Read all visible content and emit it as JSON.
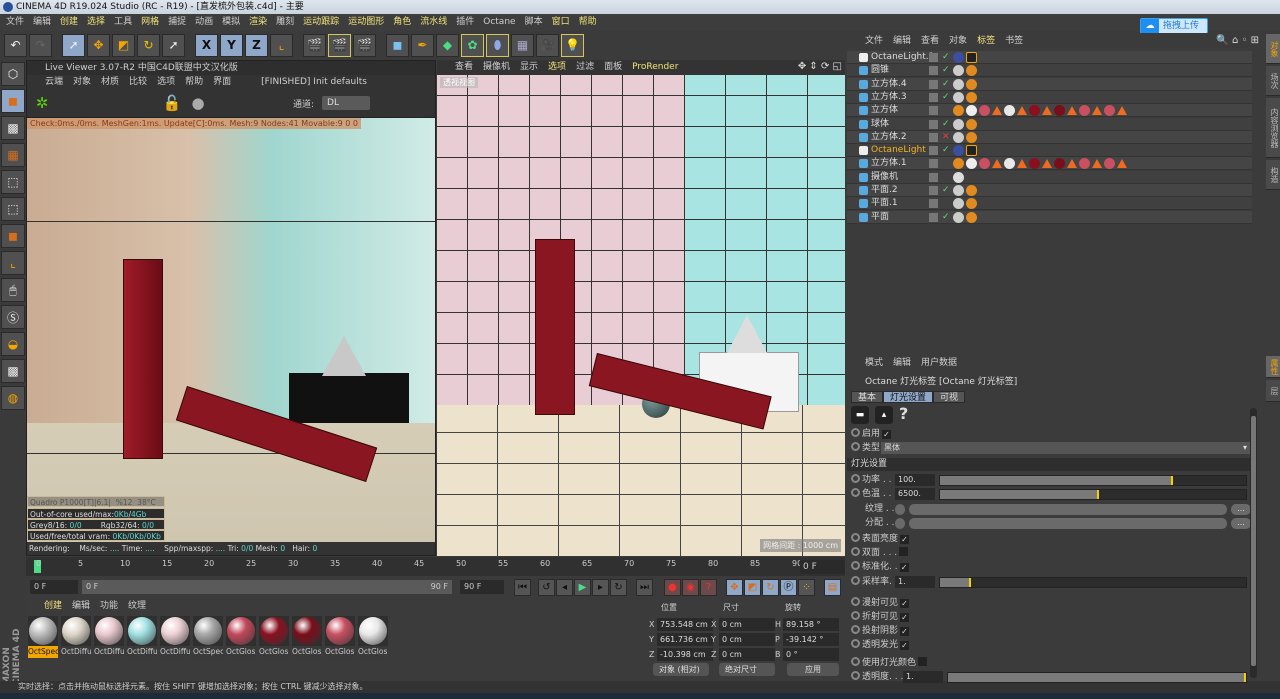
{
  "window": {
    "title": "CINEMA 4D R19.024 Studio (RC - R19) - [直发梳外包装.c4d] - 主要"
  },
  "menu": [
    "文件",
    "编辑",
    "创建",
    "选择",
    "工具",
    "网格",
    "捕捉",
    "动画",
    "模拟",
    "渲染",
    "雕刻",
    "运动跟踪",
    "运动图形",
    "角色",
    "流水线",
    "插件",
    "Octane",
    "脚本",
    "窗口",
    "帮助"
  ],
  "menu_highlighted": [
    "创建",
    "选择",
    "网格",
    "渲染",
    "运动跟踪",
    "运动图形",
    "角色",
    "流水线",
    "窗口",
    "帮助"
  ],
  "upload_button": "拖拽上传",
  "toolbar": {
    "axis": [
      "X",
      "Y",
      "Z"
    ]
  },
  "live_viewer": {
    "title": "Live Viewer 3.07-R2 中国C4D联盟中文汉化版",
    "menu": [
      "云端",
      "对象",
      "材质",
      "比较",
      "选项",
      "帮助",
      "界面"
    ],
    "status": "[FINISHED] Init defaults",
    "channel_label": "通道:",
    "channel_value": "DL",
    "check_line": "Check:0ms./0ms. MeshGen:1ms. Update[C]:0ms. Mesh:9 Nodes:41 Movable:9  0 0",
    "gpu": {
      "name": "Quadro P1000[T]|6.1|",
      "usage": "%12",
      "temp": "38°C"
    },
    "out_of_core": {
      "label": "Out-of-core used/max:",
      "used": "0Kb",
      "max": "4Gb"
    },
    "grey": {
      "label": "Grey8/16:",
      "value": "0/0"
    },
    "rgb": {
      "label": "Rgb32/64:",
      "value": "0/0"
    },
    "vram": {
      "label": "Used/free/total vram:",
      "value": "0Kb/0Kb/0Kb"
    },
    "rendering": {
      "label": "Rendering:",
      "ms_label": "Ms/sec:",
      "ms": "....",
      "time_label": "Time:",
      "time": "....",
      "spp_label": "Spp/maxspp:",
      "spp": "....",
      "tri_label": "Tri:",
      "tri": "0/0",
      "mesh_label": "Mesh:",
      "mesh": "0",
      "hair_label": "Hair:",
      "hair": "0"
    }
  },
  "viewport": {
    "menu": [
      "查看",
      "摄像机",
      "显示",
      "选项",
      "过滤",
      "面板",
      "ProRender"
    ],
    "label": "透视视图",
    "grid_distance": "网格间距 : 1000 cm"
  },
  "timeline": {
    "ticks": [
      "0",
      "5",
      "10",
      "15",
      "20",
      "25",
      "30",
      "35",
      "40",
      "45",
      "50",
      "55",
      "60",
      "65",
      "70",
      "75",
      "80",
      "85",
      "90"
    ],
    "current_frame": "0 F",
    "start": "0 F",
    "range_start": "0 F",
    "range_end": "90 F",
    "end": "90 F",
    "end_frame": "0 F"
  },
  "materials": {
    "menu": [
      "创建",
      "编辑",
      "功能",
      "纹理"
    ],
    "items": [
      {
        "label": "OctSpec",
        "color": "#bdbdbd",
        "selected": true
      },
      {
        "label": "OctDiffu",
        "color": "#ddd6c8"
      },
      {
        "label": "OctDiffu",
        "color": "#e8c8ce"
      },
      {
        "label": "OctDiffu",
        "color": "#9fe0e2"
      },
      {
        "label": "OctDiffu",
        "color": "#ecd0d4"
      },
      {
        "label": "OctSpec",
        "color": "#a8a8a8"
      },
      {
        "label": "OctGlos",
        "color": "#c2485a"
      },
      {
        "label": "OctGlos",
        "color": "#8a1020"
      },
      {
        "label": "OctGlos",
        "color": "#7a0e1a"
      },
      {
        "label": "OctGlos",
        "color": "#c85060"
      },
      {
        "label": "OctGlos",
        "color": "#e8e8e8"
      }
    ],
    "brand": "MAXON CINEMA 4D"
  },
  "coordinates": {
    "headers": [
      "位置",
      "尺寸",
      "旋转"
    ],
    "position": [
      {
        "axis": "X",
        "value": "753.548 cm"
      },
      {
        "axis": "Y",
        "value": "661.736 cm"
      },
      {
        "axis": "Z",
        "value": "-10.398 cm"
      }
    ],
    "size": [
      {
        "axis": "X",
        "value": "0 cm"
      },
      {
        "axis": "Y",
        "value": "0 cm"
      },
      {
        "axis": "Z",
        "value": "0 cm"
      }
    ],
    "rotation": [
      {
        "axis": "H",
        "value": "89.158 °"
      },
      {
        "axis": "P",
        "value": "-39.142 °"
      },
      {
        "axis": "B",
        "value": "0 °"
      }
    ],
    "mode": "对象 (相对)",
    "size_mode": "绝对尺寸",
    "apply": "应用"
  },
  "status_bar": "实时选择：点击并拖动鼠标选择元素。按住 SHIFT 键增加选择对象；按住 CTRL 键减少选择对象。",
  "object_manager": {
    "menu": [
      "文件",
      "编辑",
      "查看",
      "对象",
      "标签",
      "书签"
    ],
    "objects": [
      {
        "name": "OctaneLight.1",
        "vis": "check",
        "tags": "light"
      },
      {
        "name": "圆锥",
        "vis": "check",
        "tags": "simple"
      },
      {
        "name": "立方体.4",
        "vis": "check",
        "tags": "simple"
      },
      {
        "name": "立方体.3",
        "vis": "check",
        "tags": "simple"
      },
      {
        "name": "立方体",
        "vis": "none",
        "tags": "many"
      },
      {
        "name": "球体",
        "vis": "check",
        "tags": "simple"
      },
      {
        "name": "立方体.2",
        "vis": "cross",
        "tags": "simple"
      },
      {
        "name": "OctaneLight",
        "vis": "check",
        "tags": "light",
        "highlighted": true
      },
      {
        "name": "立方体.1",
        "vis": "none",
        "tags": "many"
      },
      {
        "name": "摄像机",
        "vis": "none",
        "tags": "camera"
      },
      {
        "name": "平面.2",
        "vis": "check",
        "tags": "simple"
      },
      {
        "name": "平面.1",
        "vis": "none",
        "tags": "simple"
      },
      {
        "name": "平面",
        "vis": "check",
        "tags": "simple"
      }
    ]
  },
  "right_tabs": [
    "对象",
    "场次",
    "内容浏览器",
    "构造"
  ],
  "attr_right_tabs": [
    "属性",
    "层"
  ],
  "attributes": {
    "menu": [
      "模式",
      "编辑",
      "用户数据"
    ],
    "title": "Octane 灯光标签 [Octane 灯光标签]",
    "tabs": [
      "基本",
      "灯光设置",
      "可视"
    ],
    "active_tab": "灯光设置",
    "help": "?",
    "enable": {
      "label": "启用",
      "checked": true
    },
    "type": {
      "label": "类型",
      "value": "黑体"
    },
    "section": "灯光设置",
    "power": {
      "label": "功率 . . .",
      "value": "100.",
      "fraction": 0.76
    },
    "temperature": {
      "label": "色温 . . .",
      "value": "6500.",
      "fraction": 0.52
    },
    "texture": {
      "label": "纹理 . . ."
    },
    "distribution": {
      "label": "分配 . . ."
    },
    "more": "...",
    "surface_brightness": {
      "label": "表面亮度",
      "checked": true
    },
    "double_sided": {
      "label": "双面 . . .",
      "checked": false
    },
    "normalize": {
      "label": "标准化. .",
      "checked": true
    },
    "sampling_rate": {
      "label": "采样率. .",
      "value": "1.",
      "fraction": 0.1
    },
    "camera_visible": {
      "label": "漫射可见",
      "checked": true
    },
    "refraction_visible": {
      "label": "折射可见",
      "checked": true
    },
    "cast_shadows": {
      "label": "投射阴影",
      "checked": true
    },
    "transparent_emission": {
      "label": "透明发光",
      "checked": true
    },
    "use_light_color": {
      "label": "使用灯光颜色",
      "checked": false
    },
    "opacity": {
      "label": "透明度. . . .",
      "value": "1.",
      "fraction": 1.0
    }
  },
  "colors": {
    "accent": "#f3a500",
    "highlight_text": "#f1e27a",
    "selected_blue": "#8fa8c9",
    "stat_value": "#5fd6d0"
  }
}
